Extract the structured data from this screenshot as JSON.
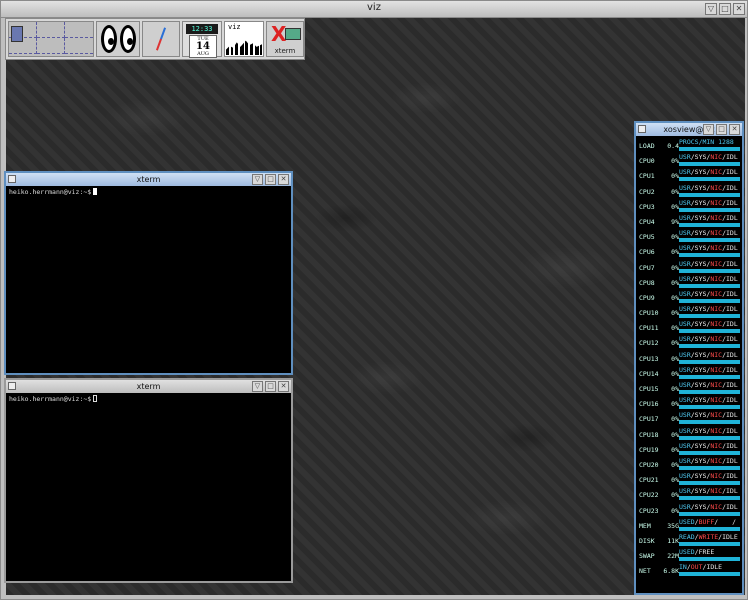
{
  "outer_window": {
    "title": "viz"
  },
  "launcher": {
    "clock_time": "12:33",
    "calendar": {
      "weekday": "TUE",
      "day": "14",
      "month": "AUG"
    },
    "load_monitor_label": "viz",
    "xterm_label": "xterm"
  },
  "xterm1": {
    "title": "xterm",
    "prompt": "heiko.herrmann@viz:~$"
  },
  "xterm2": {
    "title": "xterm",
    "prompt": "heiko.herrmann@viz:~$"
  },
  "xosview": {
    "title": "xosview@viz",
    "load": {
      "name": "LOAD",
      "value": "0.4",
      "legend": "PROCS/MIN 1288"
    },
    "cpu_legend": {
      "usr": "USR",
      "sys": "SYS",
      "nice": "NIC",
      "idle": "IDL"
    },
    "cpus": [
      {
        "name": "CPU0",
        "value": "0%"
      },
      {
        "name": "CPU1",
        "value": "0%"
      },
      {
        "name": "CPU2",
        "value": "0%"
      },
      {
        "name": "CPU3",
        "value": "0%"
      },
      {
        "name": "CPU4",
        "value": "9%"
      },
      {
        "name": "CPU5",
        "value": "0%"
      },
      {
        "name": "CPU6",
        "value": "0%"
      },
      {
        "name": "CPU7",
        "value": "0%"
      },
      {
        "name": "CPU8",
        "value": "0%"
      },
      {
        "name": "CPU9",
        "value": "0%"
      },
      {
        "name": "CPU10",
        "value": "0%"
      },
      {
        "name": "CPU11",
        "value": "0%"
      },
      {
        "name": "CPU12",
        "value": "0%"
      },
      {
        "name": "CPU13",
        "value": "0%"
      },
      {
        "name": "CPU14",
        "value": "0%"
      },
      {
        "name": "CPU15",
        "value": "0%"
      },
      {
        "name": "CPU16",
        "value": "0%"
      },
      {
        "name": "CPU17",
        "value": "0%"
      },
      {
        "name": "CPU18",
        "value": "0%"
      },
      {
        "name": "CPU19",
        "value": "0%"
      },
      {
        "name": "CPU20",
        "value": "0%"
      },
      {
        "name": "CPU21",
        "value": "0%"
      },
      {
        "name": "CPU22",
        "value": "0%"
      },
      {
        "name": "CPU23",
        "value": "0%"
      }
    ],
    "mem": {
      "name": "MEM",
      "value": "35G",
      "legend": [
        "USED",
        "BUFF",
        "/"
      ]
    },
    "disk": {
      "name": "DISK",
      "value": "11K",
      "legend": [
        "READ",
        "WRITE",
        "IDLE"
      ]
    },
    "swap": {
      "name": "SWAP",
      "value": "22M",
      "legend": [
        "USED",
        "FREE"
      ]
    },
    "net": {
      "name": "NET",
      "value": "6.8K",
      "legend": [
        "IN",
        "OUT",
        "IDLE"
      ]
    }
  }
}
